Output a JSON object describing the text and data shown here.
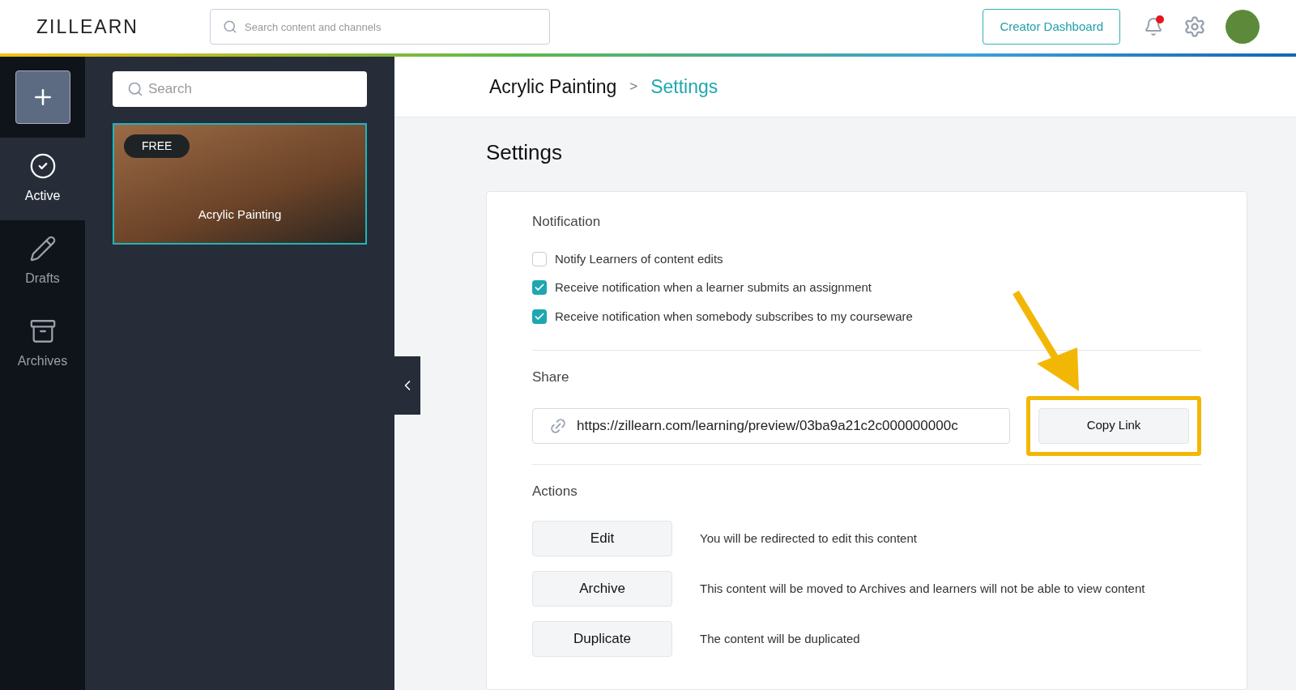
{
  "header": {
    "logo": "ZILLEARN",
    "search": {
      "placeholder": "Search content and channels"
    },
    "creator_button": "Creator Dashboard",
    "notifications": {
      "unread": true
    }
  },
  "rail": {
    "items": [
      {
        "label": "Active",
        "kind": "active",
        "selected": true
      },
      {
        "label": "Drafts",
        "kind": "drafts",
        "selected": false
      },
      {
        "label": "Archives",
        "kind": "archives",
        "selected": false
      }
    ]
  },
  "panel": {
    "search": {
      "placeholder": "Search"
    },
    "cards": [
      {
        "title": "Acrylic Painting",
        "badge": "FREE",
        "selected": true
      }
    ]
  },
  "breadcrumb": [
    {
      "label": "Acrylic Painting",
      "current": false
    },
    {
      "label": "Settings",
      "current": true
    }
  ],
  "breadcrumb_separator": ">",
  "page_title": "Settings",
  "notification": {
    "heading": "Notification",
    "options": [
      {
        "label": "Notify Learners of content edits",
        "checked": false
      },
      {
        "label": "Receive notification when a learner submits an assignment",
        "checked": true
      },
      {
        "label": "Receive notification when somebody subscribes to my courseware",
        "checked": true
      }
    ]
  },
  "share": {
    "heading": "Share",
    "url": "https://zillearn.com/learning/preview/03ba9a21c2c000000000c",
    "button": "Copy Link",
    "highlighted": true
  },
  "actions": {
    "heading": "Actions",
    "items": [
      {
        "button": "Edit",
        "description": "You will be redirected to edit this content"
      },
      {
        "button": "Archive",
        "description": "This content will be moved to Archives and learners will not be able to view content"
      },
      {
        "button": "Duplicate",
        "description": "The content will be duplicated"
      }
    ]
  }
}
